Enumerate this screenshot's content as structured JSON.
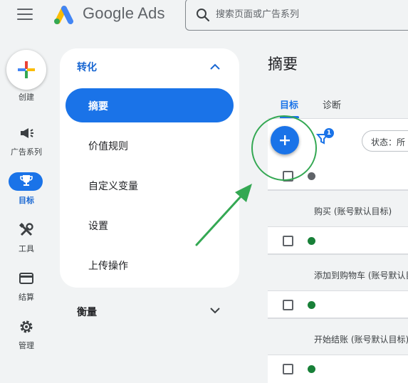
{
  "app": {
    "logo_text": "Google Ads"
  },
  "search": {
    "placeholder": "搜索页面或广告系列"
  },
  "rail": {
    "create_label": "创建",
    "items": [
      {
        "label": "广告系列",
        "icon": "megaphone-icon"
      },
      {
        "label": "目标",
        "icon": "trophy-icon",
        "active": true
      },
      {
        "label": "工具",
        "icon": "tools-icon"
      },
      {
        "label": "结算",
        "icon": "credit-card-icon"
      },
      {
        "label": "管理",
        "icon": "gear-icon"
      }
    ]
  },
  "nav": {
    "section_title": "转化",
    "items": [
      {
        "label": "摘要",
        "active": true
      },
      {
        "label": "价值规则"
      },
      {
        "label": "自定义变量"
      },
      {
        "label": "设置"
      },
      {
        "label": "上传操作"
      }
    ],
    "collapsed_section": "衡量"
  },
  "main": {
    "title": "摘要",
    "tabs": [
      {
        "label": "目标",
        "active": true
      },
      {
        "label": "诊断"
      }
    ],
    "filter_badge": "1",
    "status_filter": "状态：所",
    "groups": [
      {
        "label": "购买 (账号默认目标)"
      },
      {
        "label": "添加到购物车 (账号默认目"
      },
      {
        "label": "开始结账 (账号默认目标)"
      }
    ]
  },
  "colors": {
    "accent": "#1a73e8",
    "status_green": "#188038",
    "annotation": "#34a853"
  }
}
